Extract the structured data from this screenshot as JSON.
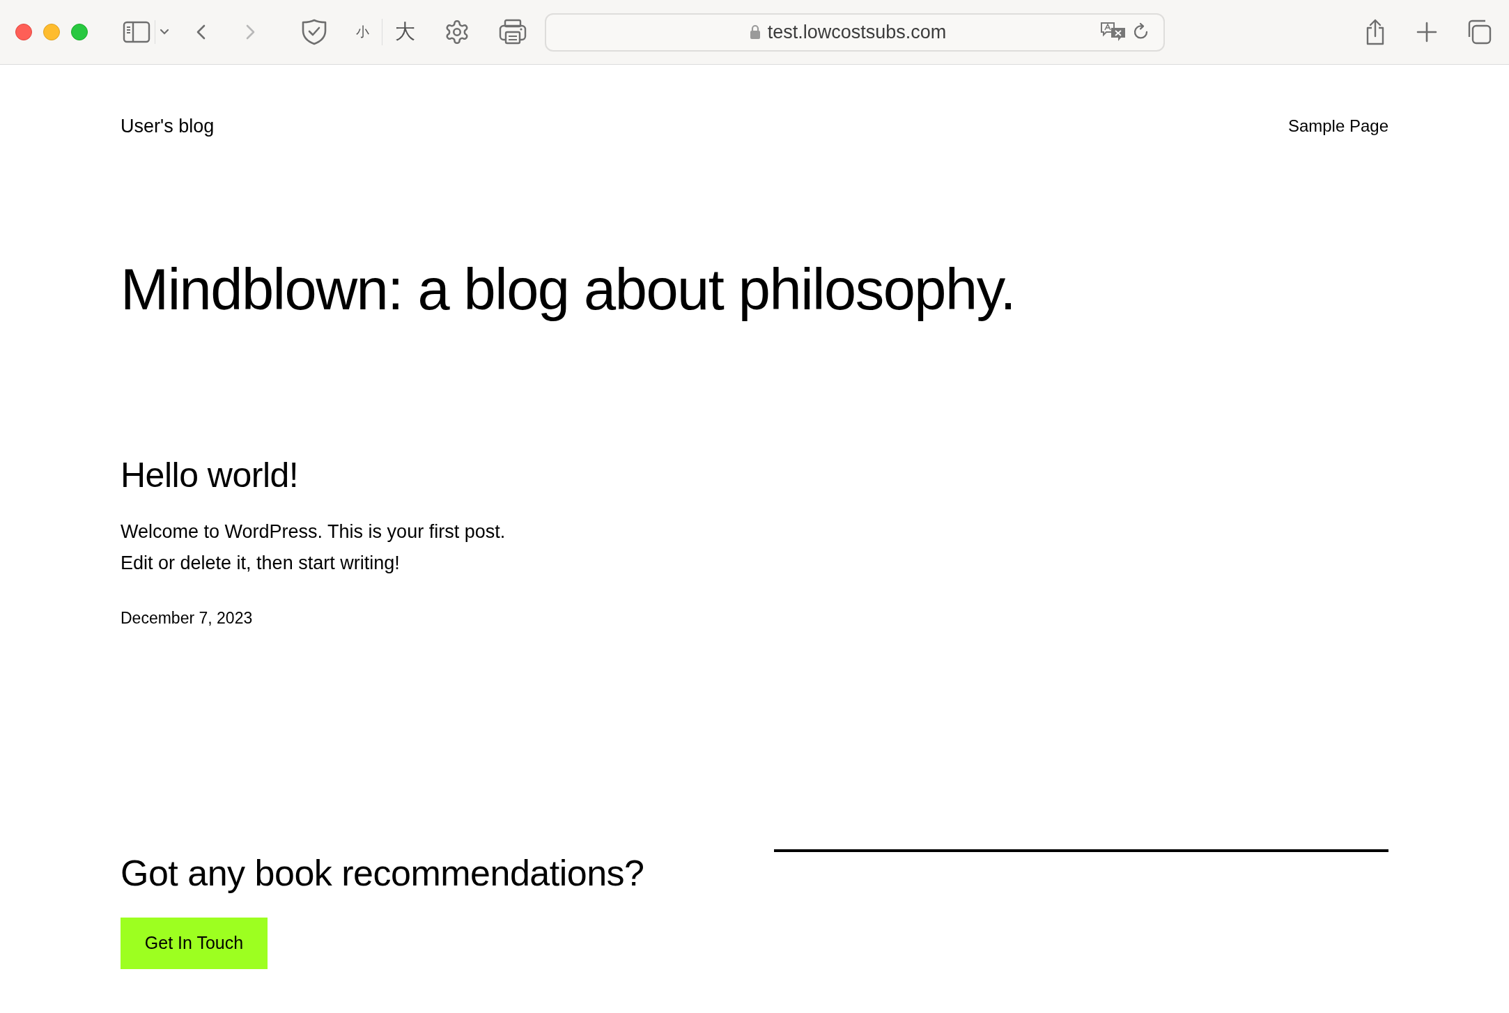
{
  "browser": {
    "url": "test.lowcostsubs.com",
    "text_size_buttons": [
      "小",
      "大"
    ],
    "nav": [
      {
        "kind": "back",
        "disabled": false
      },
      {
        "kind": "forward",
        "disabled": true
      }
    ]
  },
  "site": {
    "title": "User's blog",
    "nav_items": [
      "Sample Page"
    ]
  },
  "hero": {
    "heading": "Mindblown: a blog about philosophy."
  },
  "posts": [
    {
      "title": "Hello world!",
      "excerpt": [
        "Welcome to WordPress. This is your first post.",
        "Edit or delete it, then start writing!"
      ],
      "date": "December 7, 2023"
    }
  ],
  "footer_cta": {
    "heading": "Got any book recommendations?",
    "button": "Get In Touch"
  }
}
